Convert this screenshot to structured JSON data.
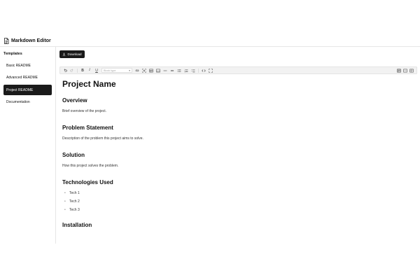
{
  "app": {
    "title": "Markdown Editor",
    "icon": "document-icon"
  },
  "sidebar": {
    "heading": "Templates",
    "items": [
      {
        "label": "Basic README",
        "active": false
      },
      {
        "label": "Advanced README",
        "active": false
      },
      {
        "label": "Project README",
        "active": true
      },
      {
        "label": "Documentation",
        "active": false
      }
    ]
  },
  "actions": {
    "download_label": "Download"
  },
  "toolbar": {
    "bold": "B",
    "italic": "I",
    "underline": "U",
    "block_type_placeholder": "Block type"
  },
  "document": {
    "title": "Project Name",
    "sections": [
      {
        "heading": "Overview",
        "text": "Brief overview of the project."
      },
      {
        "heading": "Problem Statement",
        "text": "Description of the problem this project aims to solve."
      },
      {
        "heading": "Solution",
        "text": "How this project solves the problem."
      },
      {
        "heading": "Technologies Used",
        "list": [
          "Tech 1",
          "Tech 2",
          "Tech 3"
        ]
      },
      {
        "heading": "Installation"
      }
    ]
  },
  "colors": {
    "accent": "#1a1a1a",
    "border": "#e6e6e6",
    "toolbar_bg": "#f2f2f2"
  }
}
